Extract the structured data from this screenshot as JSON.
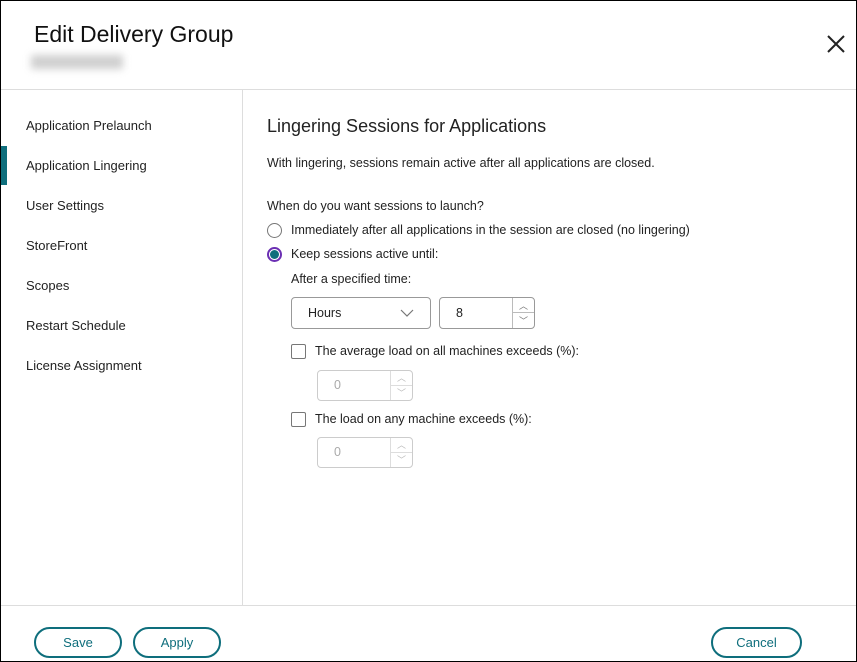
{
  "dialog": {
    "title": "Edit Delivery Group"
  },
  "sidebar": {
    "items": [
      {
        "label": "Application Prelaunch"
      },
      {
        "label": "Application Lingering",
        "active": true
      },
      {
        "label": "User Settings"
      },
      {
        "label": "StoreFront"
      },
      {
        "label": "Scopes"
      },
      {
        "label": "Restart Schedule"
      },
      {
        "label": "License Assignment"
      }
    ]
  },
  "main": {
    "heading": "Lingering Sessions for Applications",
    "description": "With lingering, sessions remain active after all applications are closed.",
    "question": "When do you want sessions to launch?",
    "option_immediate": "Immediately after all applications in the session are closed (no lingering)",
    "option_keep": "Keep sessions active until:",
    "after_time_label": "After a specified time:",
    "time_unit": "Hours",
    "time_value": "8",
    "avg_load_label": "The average load on all machines exceeds (%):",
    "avg_load_value": "0",
    "any_load_label": "The load on any machine exceeds (%):",
    "any_load_value": "0"
  },
  "footer": {
    "save": "Save",
    "apply": "Apply",
    "cancel": "Cancel"
  },
  "colors": {
    "accent": "#0e6e7c"
  }
}
